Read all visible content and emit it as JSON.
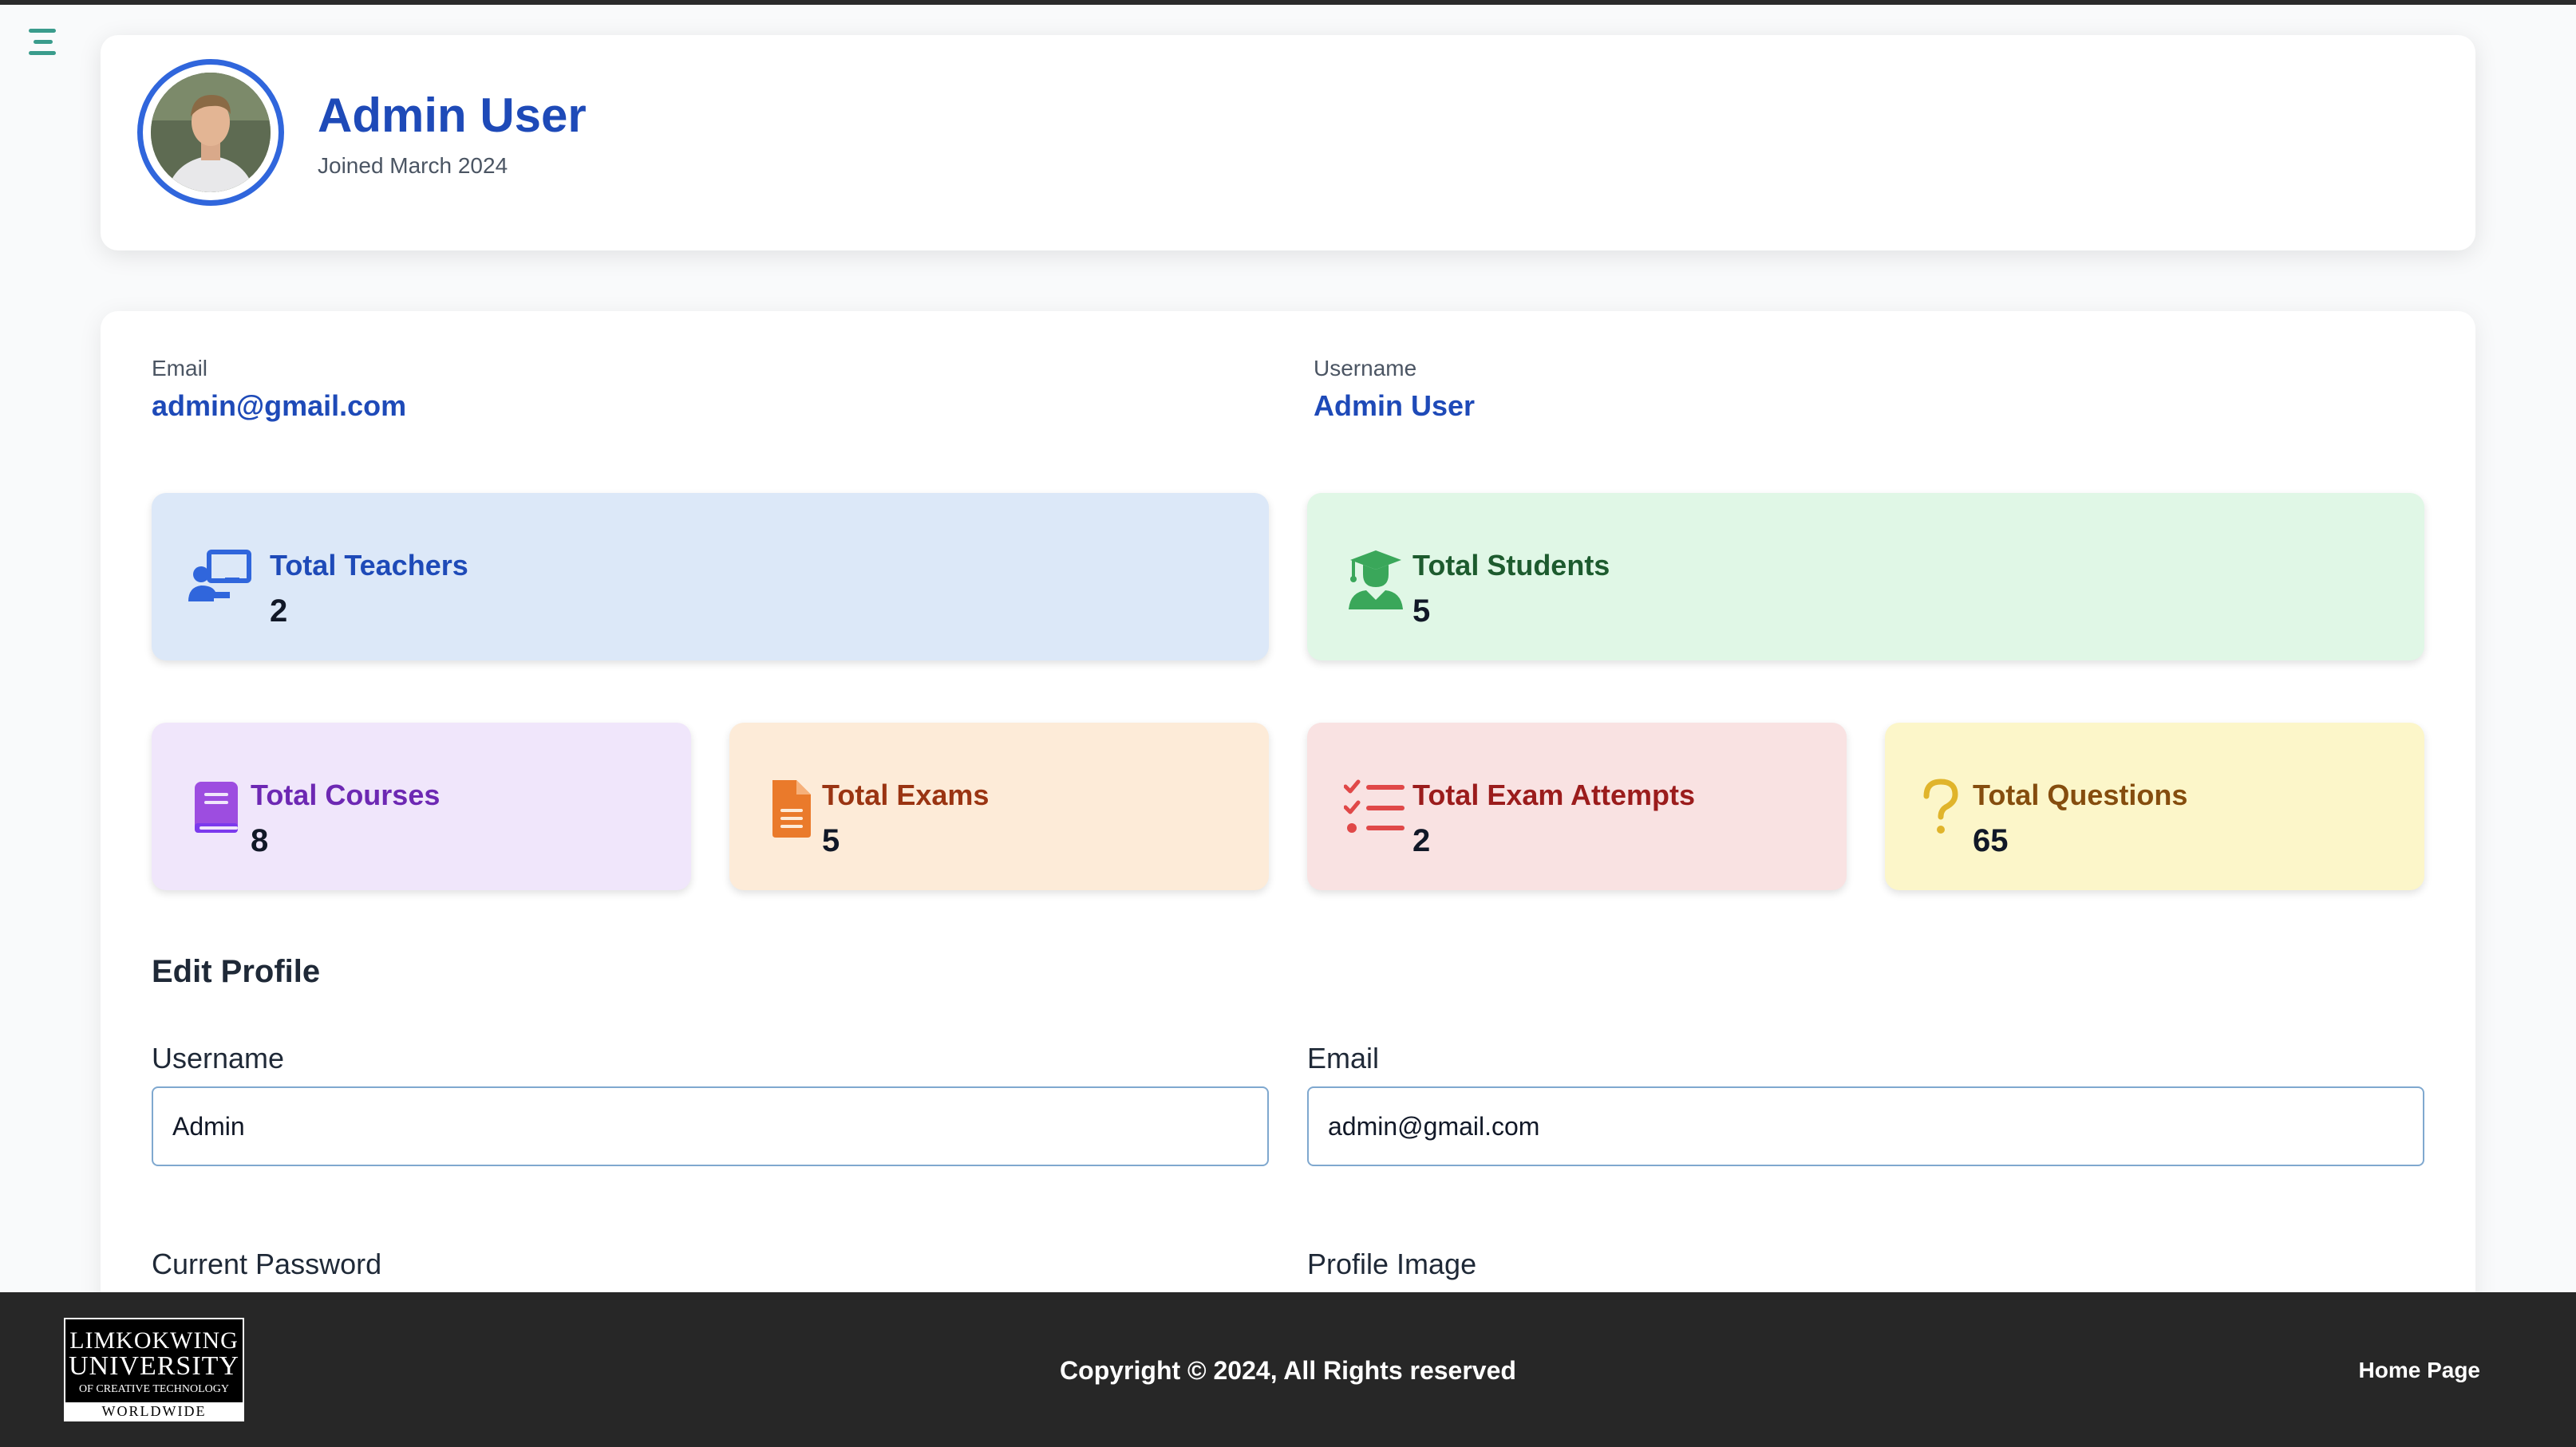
{
  "profile": {
    "name": "Admin User",
    "joined": "Joined March 2024"
  },
  "info": {
    "email_label": "Email",
    "email_value": "admin@gmail.com",
    "username_label": "Username",
    "username_value": "Admin User"
  },
  "stats": {
    "teachers": {
      "label": "Total Teachers",
      "value": "2",
      "icon": "teacher-icon",
      "bg": "#dce8f8",
      "color": "#1e4ab8"
    },
    "students": {
      "label": "Total Students",
      "value": "5",
      "icon": "graduate-icon",
      "bg": "#e0f7e6",
      "color": "#1d5b2e"
    },
    "courses": {
      "label": "Total Courses",
      "value": "8",
      "icon": "book-icon",
      "bg": "#f0e6fb",
      "color": "#6d28b3"
    },
    "exams": {
      "label": "Total Exams",
      "value": "5",
      "icon": "file-icon",
      "bg": "#fdebd8",
      "color": "#9a3412"
    },
    "attempts": {
      "label": "Total Exam Attempts",
      "value": "2",
      "icon": "checklist-icon",
      "bg": "#f9e2e2",
      "color": "#9b1c1c"
    },
    "questions": {
      "label": "Total Questions",
      "value": "65",
      "icon": "question-icon",
      "bg": "#fcf6c9",
      "color": "#854d0e"
    }
  },
  "edit_profile": {
    "title": "Edit Profile",
    "username_label": "Username",
    "username_value": "Admin",
    "email_label": "Email",
    "email_value": "admin@gmail.com",
    "current_password_label": "Current Password",
    "profile_image_label": "Profile Image"
  },
  "footer": {
    "logo_line1": "LIMKOKWING",
    "logo_line2": "UNIVERSITY",
    "logo_line3": "OF CREATIVE TECHNOLOGY",
    "logo_line4": "WORLDWIDE",
    "copyright": "Copyright © 2024, All Rights reserved",
    "home_link": "Home Page"
  },
  "colors": {
    "accent": "#1e4ab8",
    "menu_icon": "#3a9c8c",
    "footer_bg": "#272727"
  }
}
